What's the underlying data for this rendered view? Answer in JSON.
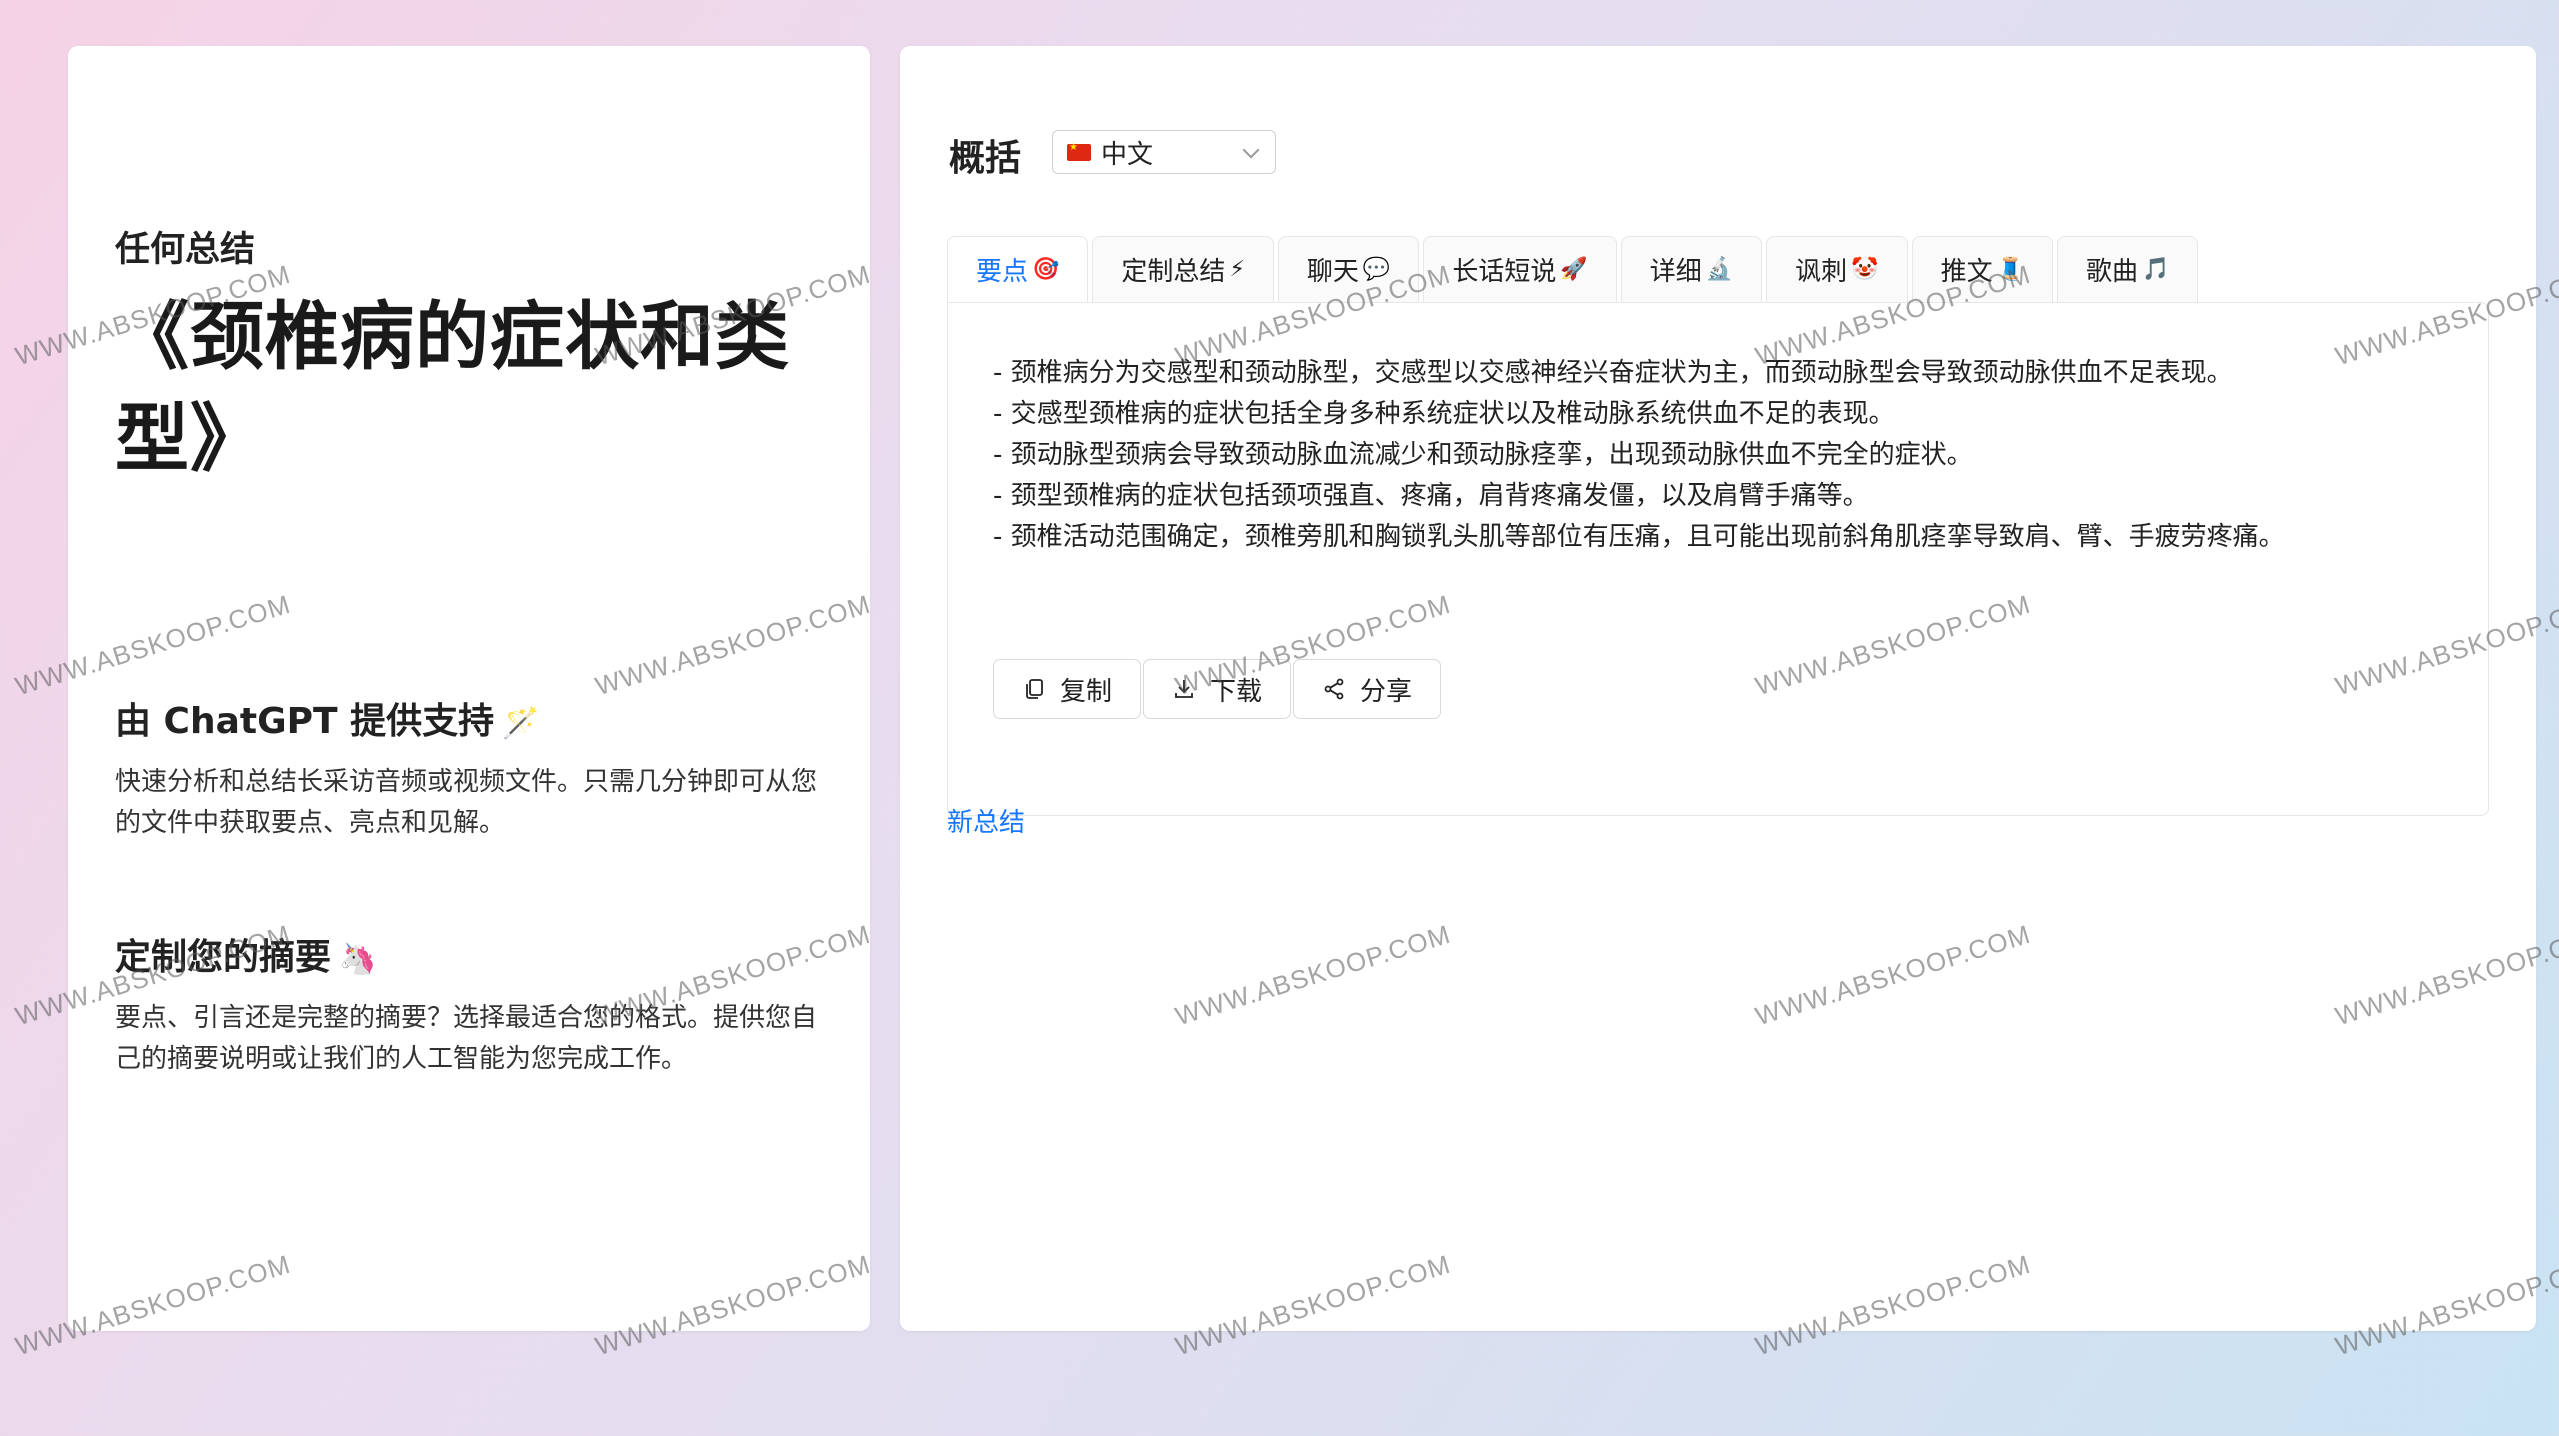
{
  "left": {
    "app_title": "任何总结",
    "doc_title": "《颈椎病的症状和类型》",
    "feature1": {
      "heading": "由 ChatGPT 提供支持",
      "emoji": "🪄",
      "desc": "快速分析和总结长采访音频或视频文件。只需几分钟即可从您的文件中获取要点、亮点和见解。"
    },
    "feature2": {
      "heading": "定制您的摘要",
      "emoji": "🦄",
      "desc": "要点、引言还是完整的摘要？选择最适合您的格式。提供您自己的摘要说明或让我们的人工智能为您完成工作。"
    }
  },
  "right": {
    "section_label": "概括",
    "language": {
      "selected": "中文",
      "icon": "china-flag-icon"
    },
    "tabs": [
      {
        "label": "要点",
        "emoji": "🎯"
      },
      {
        "label": "定制总结",
        "emoji": "⚡"
      },
      {
        "label": "聊天",
        "emoji": "💬"
      },
      {
        "label": "长话短说",
        "emoji": "🚀"
      },
      {
        "label": "详细",
        "emoji": "🔬"
      },
      {
        "label": "讽刺",
        "emoji": "🤡"
      },
      {
        "label": "推文",
        "emoji": "🧵"
      },
      {
        "label": "歌曲",
        "emoji": "🎵"
      }
    ],
    "active_tab": "要点",
    "summary_points": [
      "- 颈椎病分为交感型和颈动脉型，交感型以交感神经兴奋症状为主，而颈动脉型会导致颈动脉供血不足表现。",
      "- 交感型颈椎病的症状包括全身多种系统症状以及椎动脉系统供血不足的表现。",
      "- 颈动脉型颈病会导致颈动脉血流减少和颈动脉痉挛，出现颈动脉供血不完全的症状。",
      "- 颈型颈椎病的症状包括颈项强直、疼痛，肩背疼痛发僵，以及肩臂手痛等。",
      "- 颈椎活动范围确定，颈椎旁肌和胸锁乳头肌等部位有压痛，且可能出现前斜角肌痉挛导致肩、臂、手疲劳疼痛。"
    ],
    "actions": {
      "copy": "复制",
      "download": "下载",
      "share": "分享"
    },
    "new_summary": "新总结"
  },
  "watermark": "WWW.ABSKOOP.COM",
  "colors": {
    "accent": "#1677ff",
    "card": "#ffffff"
  }
}
